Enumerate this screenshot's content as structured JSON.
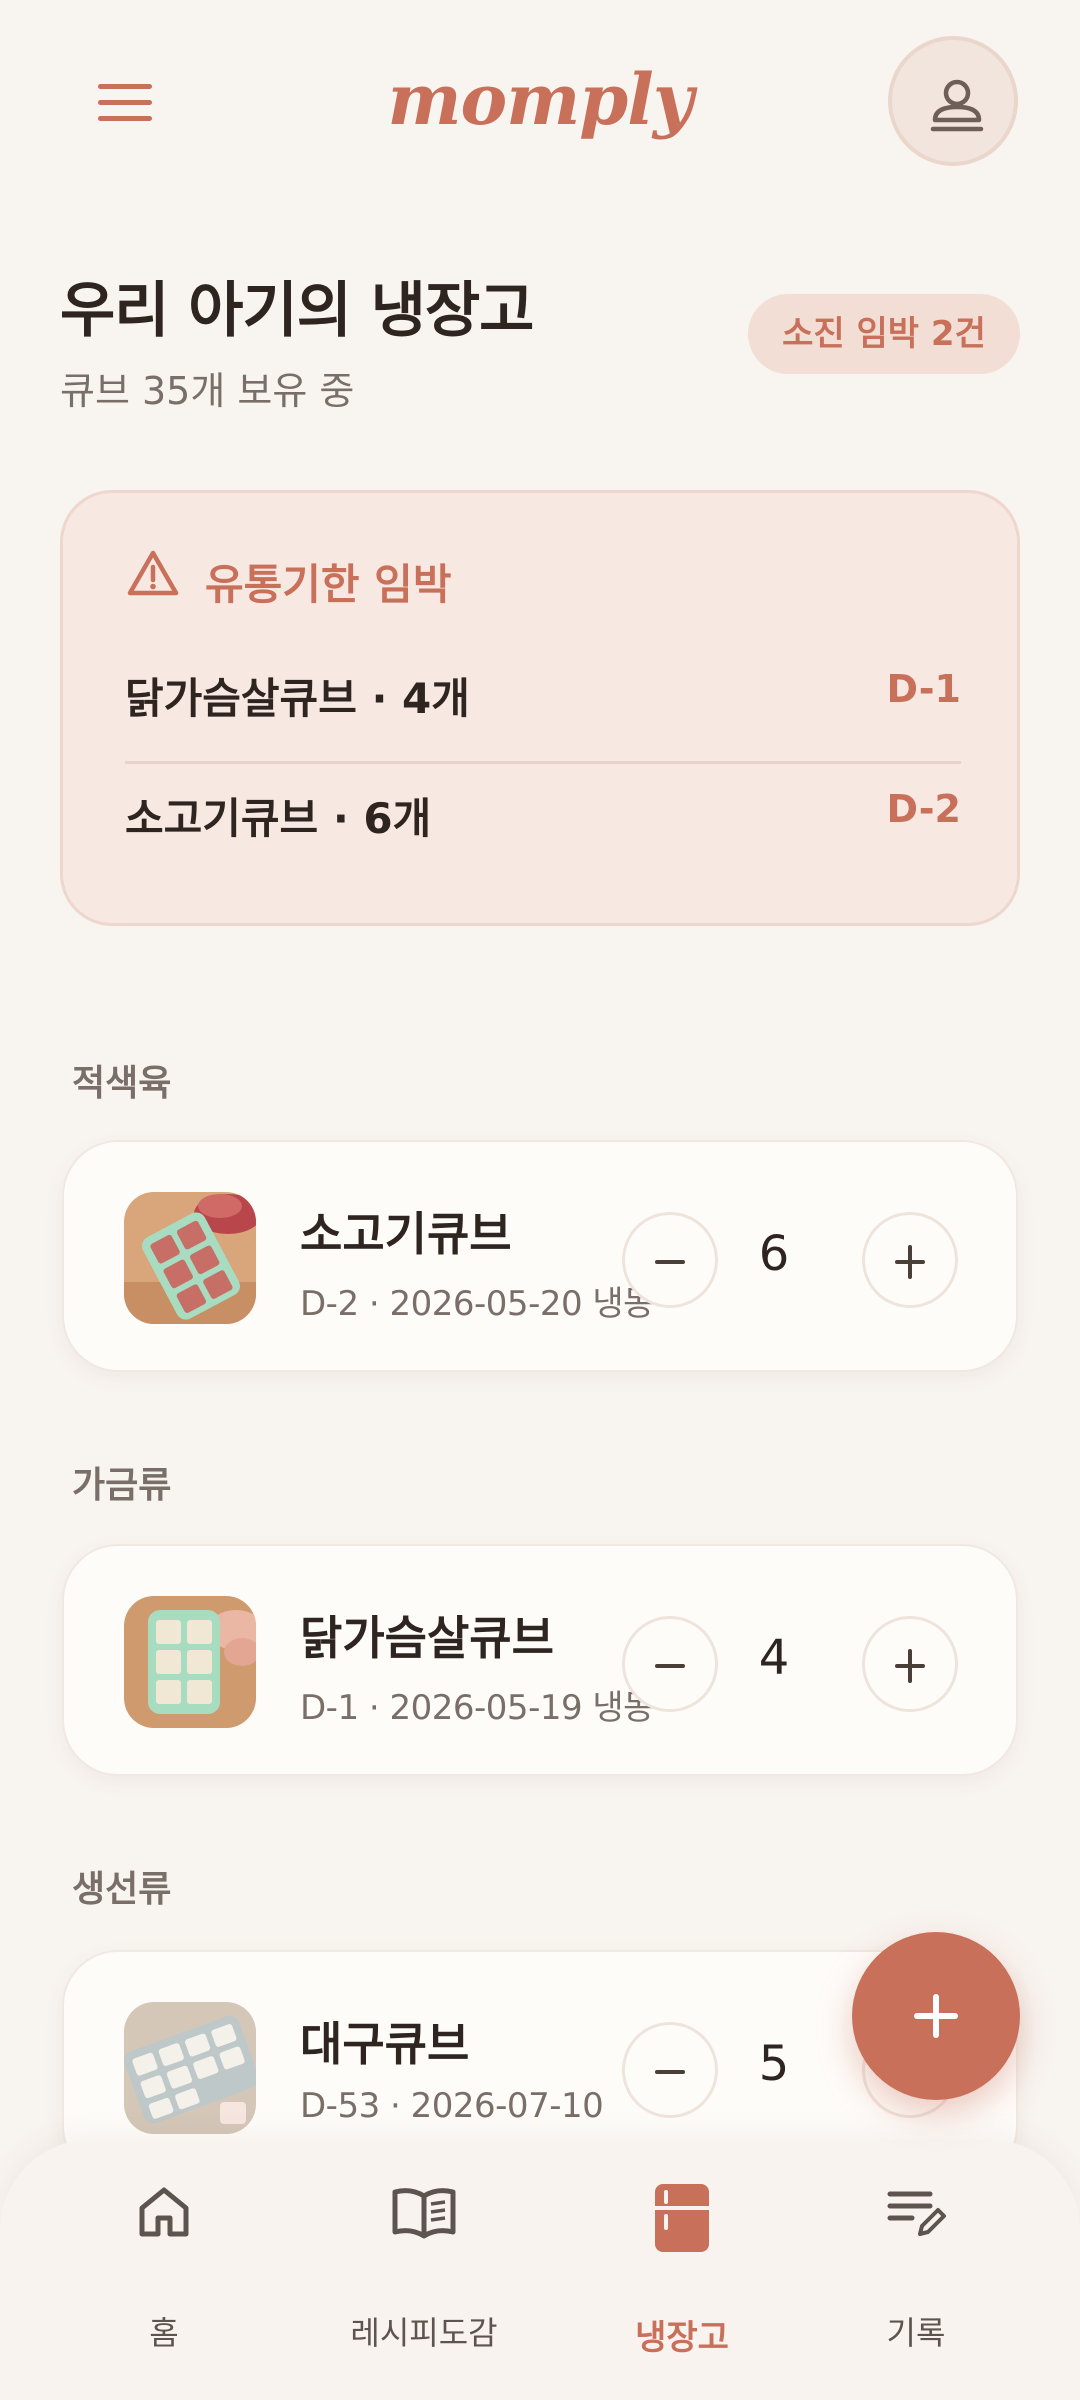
{
  "app": {
    "logo": "momply"
  },
  "header": {
    "menu_icon": "hamburger-menu-icon",
    "profile_icon": "user-icon"
  },
  "page": {
    "title": "우리 아기의 냉장고",
    "subtitle": "큐브 35개 보유 중",
    "badge": "소진 임박 2건"
  },
  "expiry": {
    "title": "유통기한 임박",
    "icon": "warning-icon",
    "items": [
      {
        "label": "닭가슴살큐브 · 4개",
        "dday": "D-1"
      },
      {
        "label": "소고기큐브 · 6개",
        "dday": "D-2"
      }
    ]
  },
  "sections": [
    {
      "label": "적색육",
      "item": {
        "name": "소고기큐브",
        "meta": "D-2 · 2026-05-20 냉동",
        "qty": "6"
      }
    },
    {
      "label": "가금류",
      "item": {
        "name": "닭가슴살큐브",
        "meta": "D-1 · 2026-05-19 냉동",
        "qty": "4"
      }
    },
    {
      "label": "생선류",
      "item": {
        "name": "대구큐브",
        "meta": "D-53 · 2026-07-10",
        "qty": "5"
      }
    }
  ],
  "fab": {
    "icon": "plus-icon"
  },
  "nav": [
    {
      "label": "홈",
      "icon": "home-icon",
      "active": false
    },
    {
      "label": "레시피도감",
      "icon": "book-icon",
      "active": false
    },
    {
      "label": "냉장고",
      "icon": "fridge-icon",
      "active": true
    },
    {
      "label": "기록",
      "icon": "edit-list-icon",
      "active": false
    }
  ],
  "colors": {
    "accent": "#C8705A",
    "background": "#F8F4F0",
    "card": "#FEFCF9",
    "alert_card": "#F7E8E2",
    "text": "#2E2420",
    "muted_text": "#7A6E68"
  }
}
